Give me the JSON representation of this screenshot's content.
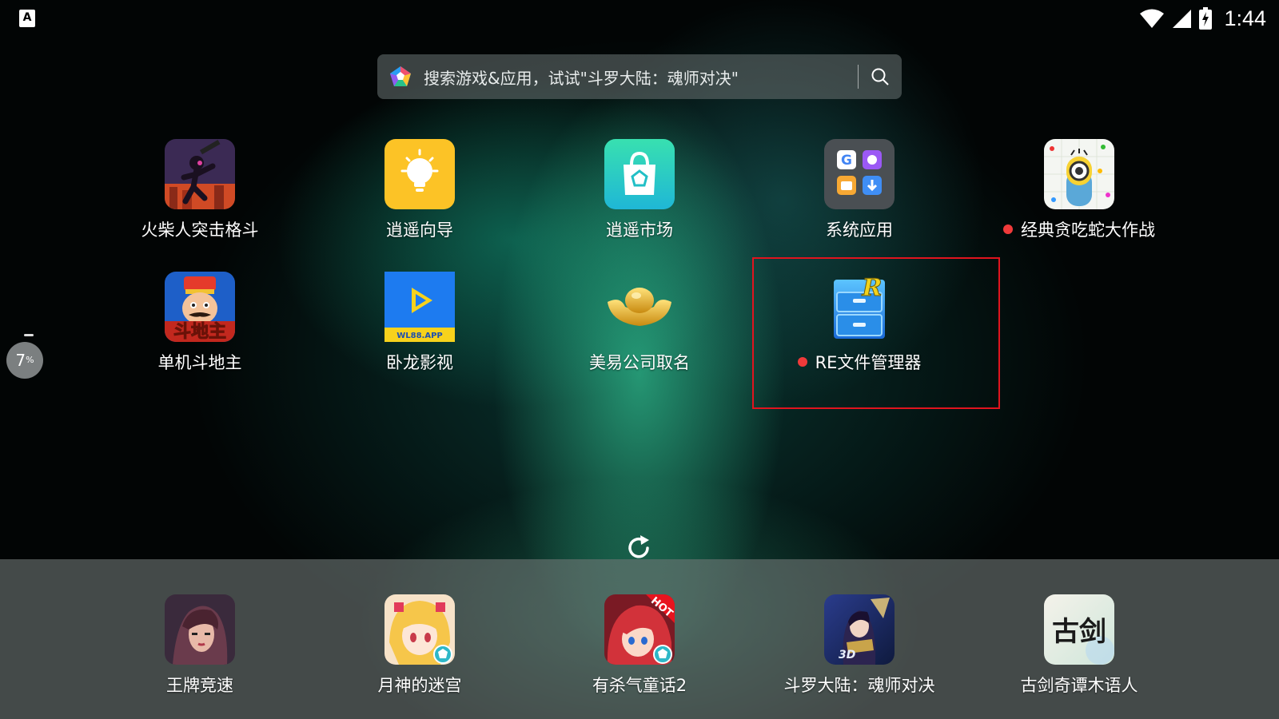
{
  "status_bar": {
    "notification_icon": "A",
    "time": "1:44",
    "icons": [
      "wifi-icon",
      "signal-icon",
      "battery-charging-icon"
    ]
  },
  "search": {
    "placeholder": "搜索游戏&应用，试试\"斗罗大陆：魂师对决\"",
    "logo": "colorful-pentagon-logo",
    "button_icon": "search-icon"
  },
  "apps": [
    {
      "label": "火柴人突击格斗",
      "icon": "stickman-fighter-icon",
      "dot": false
    },
    {
      "label": "逍遥向导",
      "icon": "lightbulb-icon",
      "dot": false
    },
    {
      "label": "逍遥市场",
      "icon": "shopping-bag-icon",
      "dot": false
    },
    {
      "label": "系统应用",
      "icon": "system-apps-folder-icon",
      "dot": false
    },
    {
      "label": "经典贪吃蛇大作战",
      "icon": "snake-game-icon",
      "dot": true
    },
    {
      "label": "单机斗地主",
      "icon": "doudizhu-icon",
      "dot": false
    },
    {
      "label": "卧龙影视",
      "icon": "play-video-icon",
      "dot": false,
      "badge_text": "WL88.APP"
    },
    {
      "label": "美易公司取名",
      "icon": "gold-ingot-icon",
      "dot": false
    },
    {
      "label": "RE文件管理器",
      "icon": "file-cabinet-icon",
      "dot": true,
      "badge_text": "R"
    }
  ],
  "floating_assistant": {
    "value": "7",
    "unit": "%"
  },
  "refresh_icon": "refresh-icon",
  "dock": [
    {
      "label": "王牌竞速",
      "icon": "racing-girl-icon"
    },
    {
      "label": "月神的迷宫",
      "icon": "anime-girl-icon"
    },
    {
      "label": "有杀气童话2",
      "icon": "red-hair-girl-icon",
      "badge_text": "HOT"
    },
    {
      "label": "斗罗大陆：魂师对决",
      "icon": "warrior-3d-icon",
      "badge_text": "3D"
    },
    {
      "label": "古剑奇谭木语人",
      "icon": "calligraphy-icon",
      "badge_text": "古剑"
    }
  ],
  "colors": {
    "accent_red": "#e0141e",
    "dot_red": "#f03a3a",
    "bulb_yellow": "#fcc326",
    "market_teal": "#2fd2c2",
    "video_blue": "#1d7bf0"
  }
}
